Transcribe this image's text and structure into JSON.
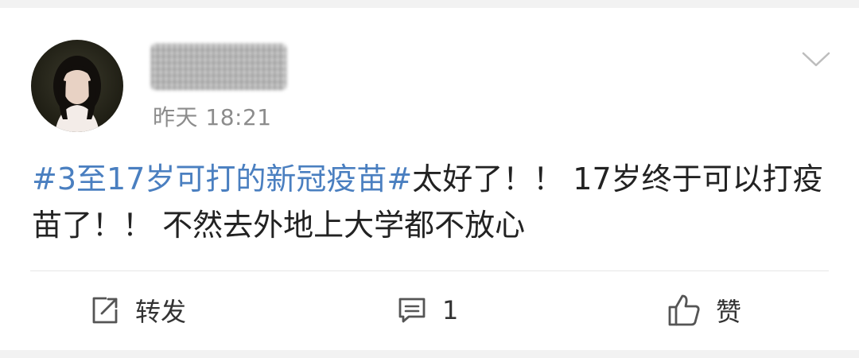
{
  "post": {
    "author_name": "",
    "timestamp": "昨天 18:21",
    "hashtag": "#3至17岁可打的新冠疫苗#",
    "body_text": "太好了！！ 17岁终于可以打疫苗了！！ 不然去外地上大学都不放心"
  },
  "actions": {
    "repost_label": "转发",
    "comment_count": "1",
    "like_label": "赞"
  },
  "icons": {
    "menu": "chevron-down-icon",
    "repost": "share-icon",
    "comment": "comment-icon",
    "like": "thumbs-up-icon"
  },
  "colors": {
    "hashtag": "#4a7fc0",
    "text": "#222222",
    "muted": "#8c8c8c",
    "background": "#f2f2f2",
    "card": "#ffffff"
  }
}
